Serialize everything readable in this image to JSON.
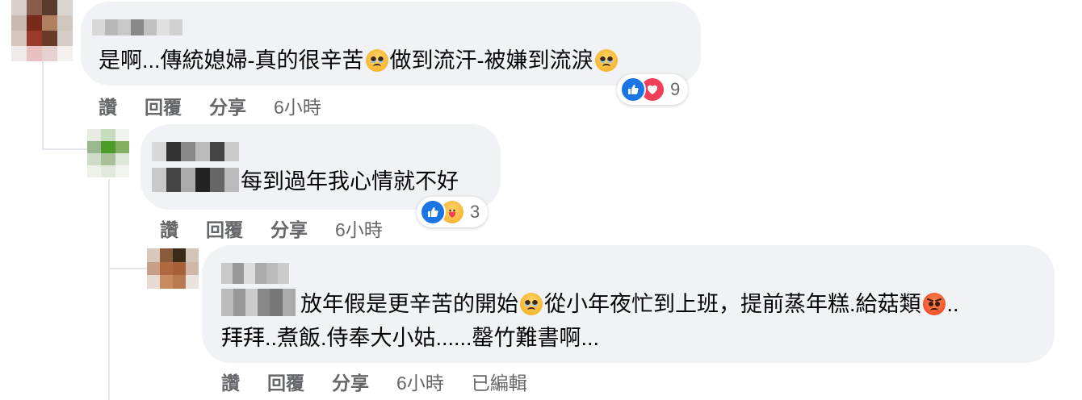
{
  "comments": [
    {
      "text_parts": [
        "是啊...傳統媳婦-真的很辛苦",
        "做到流汗-被嫌到流淚"
      ],
      "emojis": [
        "pleading-face-icon",
        "sad-face-icon"
      ],
      "actions": {
        "like": "讚",
        "reply": "回覆",
        "share": "分享",
        "time": "6小時"
      },
      "reactions": {
        "icons": [
          "like-icon",
          "love-icon"
        ],
        "count": "9"
      }
    },
    {
      "text_parts": [
        "每到過年我心情就不好"
      ],
      "actions": {
        "like": "讚",
        "reply": "回覆",
        "share": "分享",
        "time": "6小時"
      },
      "reactions": {
        "icons": [
          "like-icon",
          "care-icon"
        ],
        "count": "3"
      }
    },
    {
      "line1_parts": [
        "放年假是更辛苦的開始",
        "從小年夜忙到上班，提前蒸年糕.給菇類",
        ".."
      ],
      "line2": "拜拜..煮飯.侍奉大小姑......罄竹難書啊...",
      "emojis": [
        "pleading-face-icon",
        "angry-face-icon"
      ],
      "actions": {
        "like": "讚",
        "reply": "回覆",
        "share": "分享",
        "time": "6小時",
        "edited": "已編輯"
      }
    }
  ],
  "colors": {
    "bubble": "#f0f2f5",
    "secondary_text": "#65676b",
    "like_blue": "#1b74e4",
    "love_red": "#f33e58"
  }
}
